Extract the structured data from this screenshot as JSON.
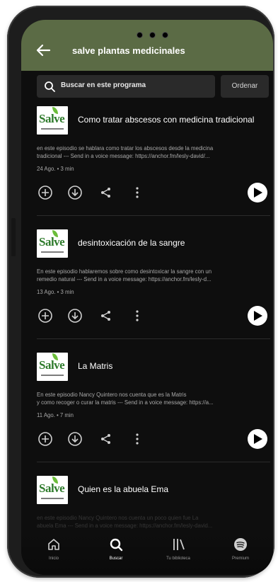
{
  "header": {
    "title": "salve plantas medicinales"
  },
  "search": {
    "placeholder": "Buscar en este programa",
    "order_label": "Ordenar"
  },
  "episodes": [
    {
      "thumb_text": "Salve",
      "title": "Como tratar abscesos con medicina tradicional",
      "desc1": "en este episodio se hablara como tratar los abscesos desde la medicina",
      "desc2": "tradicional  --- Send in a voice message: https://anchor.fm/lesly-david/...",
      "meta": "24 Ago. • 3 min"
    },
    {
      "thumb_text": "Salve",
      "title": "desintoxicación de la sangre",
      "desc1": "En este episodio hablaremos sobre como desintoxicar la sangre con un",
      "desc2": "remedio natural  --- Send in a voice message: https://anchor.fm/lesly-d...",
      "meta": "13 Ago. • 3 min"
    },
    {
      "thumb_text": "Salve",
      "title": "La Matris",
      "desc1": "En este episodio Nancy Quintero nos cuenta que es la Matris",
      "desc2": "y como recoger o curar la matris  --- Send in a voice message: https://a...",
      "meta": "11 Ago. • 7 min"
    },
    {
      "thumb_text": "Salve",
      "title": "Quien es la abuela Ema",
      "desc1": "en este episodio Nancy Quintero nos cuenta un poco quien fue La",
      "desc2": "abuela Ema  --- Send in a voice message: https://anchor.fm/lesly-david...",
      "meta": ""
    }
  ],
  "nav": [
    {
      "label": "Inicio",
      "icon": "home-icon",
      "active": false
    },
    {
      "label": "Buscar",
      "icon": "search-icon",
      "active": true
    },
    {
      "label": "Tu biblioteca",
      "icon": "library-icon",
      "active": false
    },
    {
      "label": "Premium",
      "icon": "spotify-icon",
      "active": false
    }
  ],
  "colors": {
    "header": "#5b6b45",
    "background": "#0e0e0e",
    "accent": "#ffffff"
  }
}
